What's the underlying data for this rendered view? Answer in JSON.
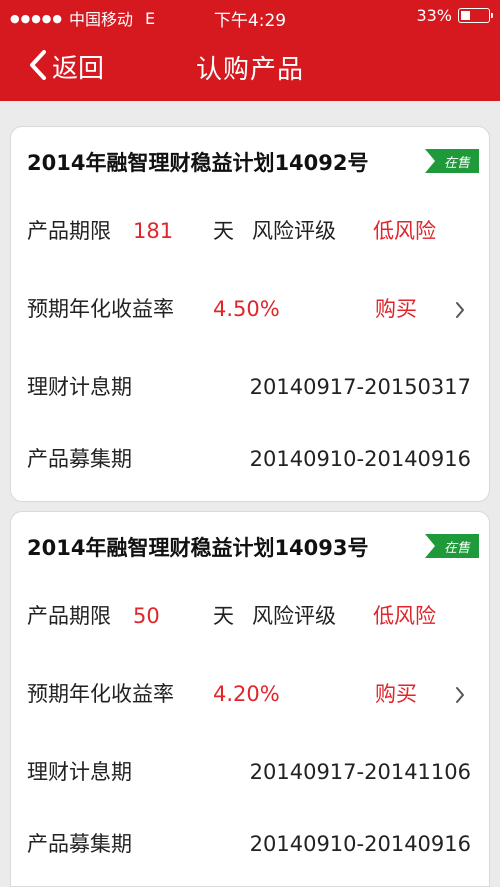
{
  "status_bar": {
    "signal_dots": "●●●●●",
    "carrier": "中国移动",
    "network": "E",
    "time": "下午4:29",
    "battery": "33%"
  },
  "nav": {
    "back_label": "返回",
    "title": "认购产品"
  },
  "products": [
    {
      "name": "2014年融智理财稳益计划14092号",
      "badge": "在售",
      "term_label": "产品期限",
      "term_value": "181",
      "term_unit": "天",
      "risk_label": "风险评级",
      "risk_value": "低风险",
      "yield_label": "预期年化收益率",
      "yield_value": "4.50%",
      "buy_label": "购买",
      "interest_label": "理财计息期",
      "interest_value": "20140917-20150317",
      "raise_label": "产品募集期",
      "raise_value": "20140910-20140916"
    },
    {
      "name": "2014年融智理财稳益计划14093号",
      "badge": "在售",
      "term_label": "产品期限",
      "term_value": "50",
      "term_unit": "天",
      "risk_label": "风险评级",
      "risk_value": "低风险",
      "yield_label": "预期年化收益率",
      "yield_value": "4.20%",
      "buy_label": "购买",
      "interest_label": "理财计息期",
      "interest_value": "20140917-20141106",
      "raise_label": "产品募集期",
      "raise_value": "20140910-20140916"
    }
  ],
  "colors": {
    "brand_red": "#d6181f",
    "accent_red": "#e0262b",
    "badge_green": "#1f9a3a"
  }
}
